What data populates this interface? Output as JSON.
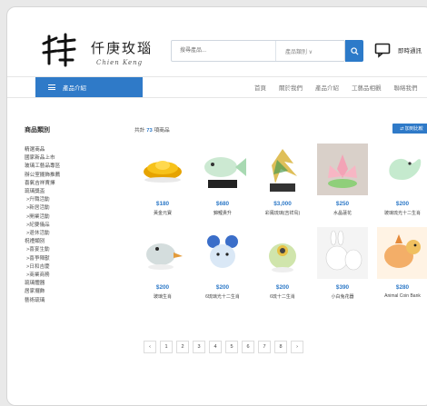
{
  "header": {
    "brand_cn": "仟庚玫瑙",
    "brand_en": "Chien Keng",
    "search_placeholder": "搜尋產品...",
    "search_category": "產品類別 ∨",
    "chat_label": "即時通訊"
  },
  "nav": {
    "menu_label": "產品介紹",
    "links": [
      "首頁",
      "關於我們",
      "產品介紹",
      "工藝品相觀",
      "聯絡我們"
    ]
  },
  "sidebar": {
    "title": "商品類別",
    "categories": [
      {
        "label": "精選商品",
        "sub": false
      },
      {
        "label": "國家新品上市",
        "sub": false
      },
      {
        "label": "玻璃工藝品專區",
        "sub": false
      },
      {
        "label": "辦公室擺飾推薦",
        "sub": false
      },
      {
        "label": "喜氣吉祥賣擇",
        "sub": false
      },
      {
        "label": "琉璃獎盃",
        "sub": false
      },
      {
        "label": ">升職活動",
        "sub": true
      },
      {
        "label": ">新居活動",
        "sub": true
      },
      {
        "label": ">開業活動",
        "sub": true
      },
      {
        "label": ">紀要儀品",
        "sub": true
      },
      {
        "label": ">退休活動",
        "sub": true
      },
      {
        "label": "祝禮類別",
        "sub": false
      },
      {
        "label": ">喜宴生動",
        "sub": true
      },
      {
        "label": ">喜爭陣獸",
        "sub": true
      },
      {
        "label": ">日和吉慶",
        "sub": true
      },
      {
        "label": ">商業商務",
        "sub": true
      },
      {
        "label": "琉璃體器",
        "sub": false
      },
      {
        "label": "居家擺飾",
        "sub": false
      },
      {
        "label": "藝術琉璃",
        "sub": false
      }
    ]
  },
  "main": {
    "count_prefix": "共計",
    "count_value": "73",
    "count_suffix": "項商品",
    "compare_label": "⇄ 加到比較",
    "products": [
      {
        "price": "$180",
        "name": "黃金元寶",
        "icon": "gold-ingot"
      },
      {
        "price": "$680",
        "name": "錦鯉貴升",
        "icon": "glass-fish"
      },
      {
        "price": "$3,000",
        "name": "彩鳳琉璃(吉祥鳥)",
        "icon": "glass-phoenix"
      },
      {
        "price": "$250",
        "name": "水晶蓮花",
        "icon": "crystal-lotus"
      },
      {
        "price": "$200",
        "name": "玻璃琉光十二生肖",
        "icon": "glass-zodiac-dragon"
      },
      {
        "price": "$200",
        "name": "玻璃生肖",
        "icon": "glass-bird"
      },
      {
        "price": "$200",
        "name": "6琉璃光十二生肖",
        "icon": "glass-mouse"
      },
      {
        "price": "$200",
        "name": "6琉十二生肖",
        "icon": "glass-chick"
      },
      {
        "price": "$390",
        "name": "小白兔花器",
        "icon": "white-rabbit-vase"
      },
      {
        "price": "$280",
        "name": "Animal Coin Bank",
        "icon": "animal-coin-bank"
      }
    ]
  },
  "pagination": {
    "pages": [
      "‹",
      "1",
      "2",
      "3",
      "4",
      "5",
      "6",
      "7",
      "8",
      "›"
    ]
  },
  "colors": {
    "accent": "#2f7ac8",
    "border": "#d6d6d6"
  }
}
